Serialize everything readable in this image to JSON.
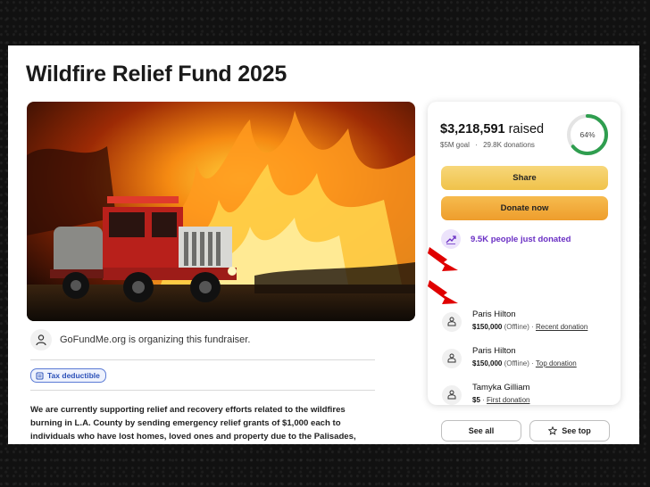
{
  "page": {
    "title": "Wildfire Relief Fund 2025"
  },
  "organizer": {
    "icon": "user-icon",
    "text": "GoFundMe.org is organizing this fundraiser."
  },
  "badge": {
    "icon": "receipt-icon",
    "label": "Tax deductible"
  },
  "description": "We are currently supporting relief and recovery efforts related to the wildfires burning in L.A. County by sending emergency relief grants of $1,000 each to individuals who have lost homes, loved ones and property due to the Palisades, Eaton and Hurst fires.",
  "donation_card": {
    "raised_amount": "$3,218,591",
    "raised_suffix": " raised",
    "goal": "$5M goal",
    "donations": "29.8K donations",
    "progress_label": "64%",
    "progress_fraction": 0.64,
    "colors": {
      "progress": "#2f9e4f",
      "progress_track": "#e4e4e4",
      "recent_text": "#6a2fc4"
    },
    "share_label": "Share",
    "donate_label": "Donate now",
    "recent_activity": "9.5K people just donated",
    "donors": [
      {
        "name": "Paris Hilton",
        "amount": "$150,000",
        "status": "(Offline)",
        "tag": "Recent donation"
      },
      {
        "name": "Paris Hilton",
        "amount": "$150,000",
        "status": "(Offline)",
        "tag": "Top donation"
      },
      {
        "name": "Tamyka Gilliam",
        "amount": "$5",
        "status": "",
        "tag": "First donation"
      }
    ],
    "see_all_label": "See all",
    "see_top_label": "See top"
  }
}
